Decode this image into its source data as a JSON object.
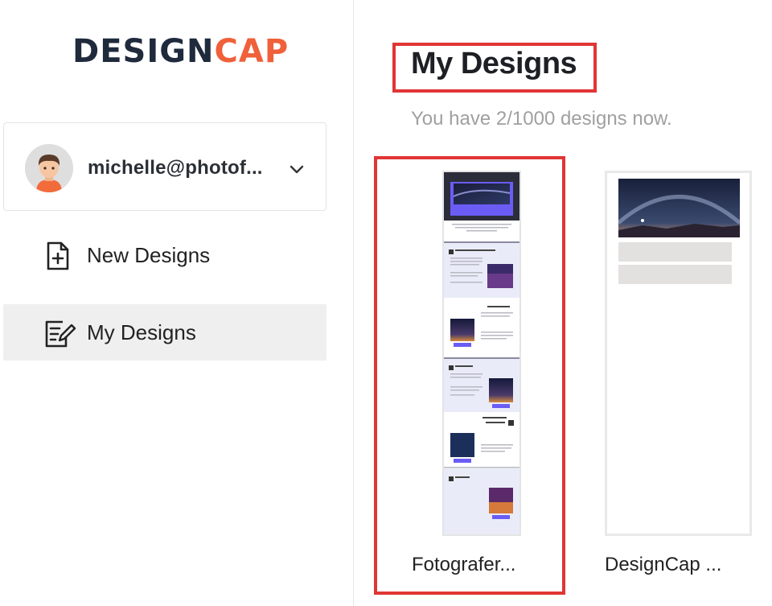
{
  "logo": {
    "part1": "DESIGN",
    "part2": "CAP"
  },
  "account": {
    "email": "michelle@photof..."
  },
  "nav": [
    {
      "label": "New Designs",
      "icon": "new-document-icon"
    },
    {
      "label": "My Designs",
      "icon": "edit-document-icon"
    }
  ],
  "main": {
    "title": "My Designs",
    "subtitle": "You have 2/1000 designs now."
  },
  "designs": [
    {
      "name": "Fotografer..."
    },
    {
      "name": "DesignCap ..."
    }
  ],
  "colors": {
    "logo_dark": "#1f2a3c",
    "logo_accent": "#f0603a",
    "highlight": "#e03535",
    "active_nav": "#efefef",
    "thumb_accent": "#6a5cf5"
  }
}
